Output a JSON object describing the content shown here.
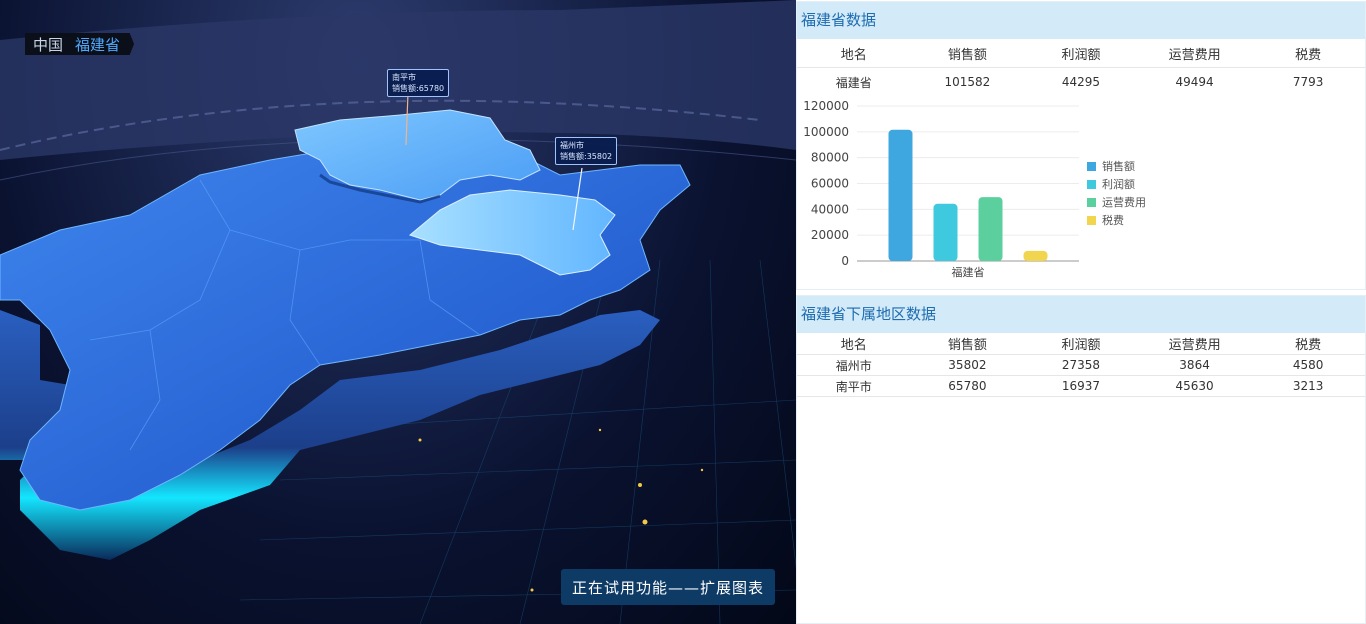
{
  "map": {
    "breadcrumb": [
      "中国",
      "福建省"
    ],
    "labels": [
      {
        "name": "南平市",
        "value_line": "销售额:65780"
      },
      {
        "name": "福州市",
        "value_line": "销售额:35802"
      }
    ],
    "trial_banner": "正在试用功能——扩展图表"
  },
  "province_panel": {
    "title": "福建省数据",
    "columns": [
      "地名",
      "销售额",
      "利润额",
      "运营费用",
      "税费"
    ],
    "row": [
      "福建省",
      "101582",
      "44295",
      "49494",
      "7793"
    ]
  },
  "regions_panel": {
    "title": "福建省下属地区数据",
    "columns": [
      "地名",
      "销售额",
      "利润额",
      "运营费用",
      "税费"
    ],
    "rows": [
      [
        "福州市",
        "35802",
        "27358",
        "3864",
        "4580"
      ],
      [
        "南平市",
        "65780",
        "16937",
        "45630",
        "3213"
      ]
    ]
  },
  "colors": {
    "销售额": "#3fa7df",
    "利润额": "#3ec9de",
    "运营费用": "#5ccf9f",
    "税费": "#f1d54f"
  },
  "chart_data": {
    "type": "bar",
    "categories": [
      "福建省"
    ],
    "series": [
      {
        "name": "销售额",
        "values": [
          101582
        ]
      },
      {
        "name": "利润额",
        "values": [
          44295
        ]
      },
      {
        "name": "运营费用",
        "values": [
          49494
        ]
      },
      {
        "name": "税费",
        "values": [
          7793
        ]
      }
    ],
    "ylim": [
      0,
      120000
    ],
    "yticks": [
      0,
      20000,
      40000,
      60000,
      80000,
      100000,
      120000
    ],
    "legend_position": "right",
    "grid": true
  }
}
